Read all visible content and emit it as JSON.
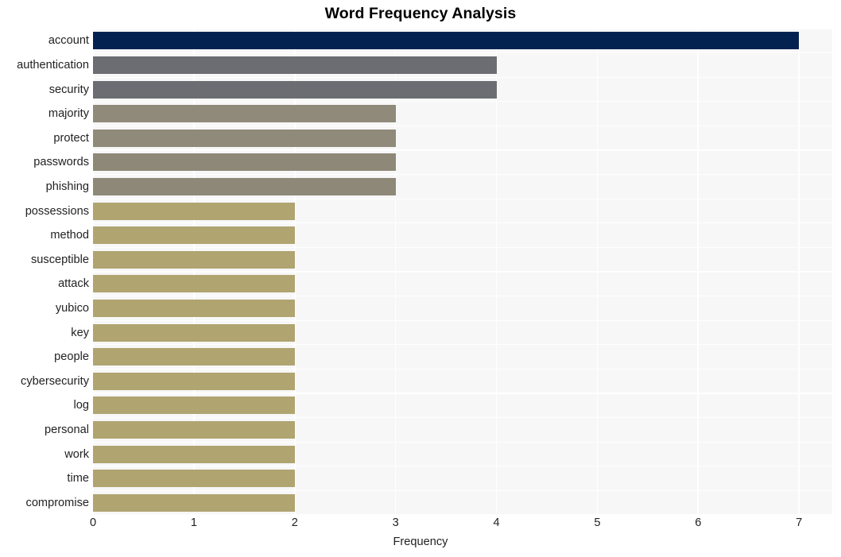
{
  "chart_data": {
    "type": "bar",
    "orientation": "horizontal",
    "title": "Word Frequency Analysis",
    "xlabel": "Frequency",
    "ylabel": "",
    "xlim": [
      0,
      7.33
    ],
    "xticks": [
      0,
      1,
      2,
      3,
      4,
      5,
      6,
      7
    ],
    "xtick_labels": [
      "0",
      "1",
      "2",
      "3",
      "4",
      "5",
      "6",
      "7"
    ],
    "grid": true,
    "grid_color": "#ffffff",
    "plot_background": "#f7f7f7",
    "figure_background": "#ffffff",
    "legend": null,
    "categories": [
      "account",
      "authentication",
      "security",
      "majority",
      "protect",
      "passwords",
      "phishing",
      "possessions",
      "method",
      "susceptible",
      "attack",
      "yubico",
      "key",
      "people",
      "cybersecurity",
      "log",
      "personal",
      "work",
      "time",
      "compromise"
    ],
    "values": [
      7,
      4,
      4,
      3,
      3,
      3,
      3,
      2,
      2,
      2,
      2,
      2,
      2,
      2,
      2,
      2,
      2,
      2,
      2,
      2
    ],
    "bar_colors": [
      "#04224f",
      "#6c6d72",
      "#6c6d72",
      "#8f8a7a",
      "#8f8a7a",
      "#8e8878",
      "#8e8878",
      "#b0a471",
      "#b0a471",
      "#b0a471",
      "#b0a471",
      "#b0a471",
      "#b0a471",
      "#b0a471",
      "#b0a471",
      "#b0a471",
      "#b0a471",
      "#b0a471",
      "#b0a471",
      "#b0a471"
    ]
  }
}
